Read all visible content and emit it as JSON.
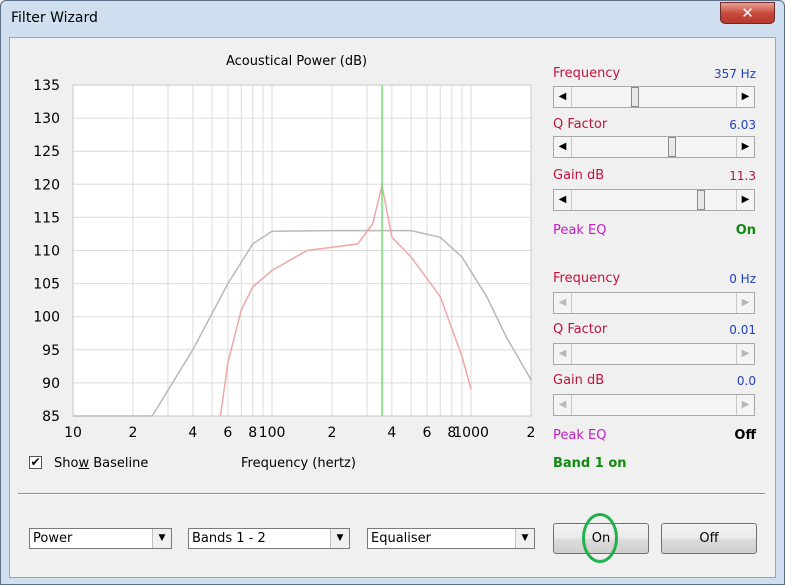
{
  "window": {
    "title": "Filter Wizard",
    "close_glyph": "✕"
  },
  "chart_data": {
    "type": "line",
    "title": "Acoustical Power (dB)",
    "xlabel": "Frequency (hertz)",
    "ylabel": "",
    "x_scale": "log",
    "xlim": [
      10,
      2000
    ],
    "ylim": [
      85,
      135
    ],
    "y_ticks": [
      "135",
      "130",
      "125",
      "120",
      "115",
      "110",
      "105",
      "100",
      "95",
      "90",
      "85"
    ],
    "x_ticks": [
      "10",
      "2",
      "4",
      "6",
      "8",
      "100",
      "2",
      "4",
      "6",
      "8",
      "1000",
      "2"
    ],
    "grid": true,
    "marker_frequency": 357,
    "series": [
      {
        "color": "#b8b8b8",
        "x": [
          10,
          25,
          40,
          60,
          80,
          100,
          200,
          500,
          700,
          900,
          1200,
          1500,
          2000
        ],
        "y": [
          85,
          85,
          95,
          105,
          111,
          112.9,
          113,
          113,
          112,
          109,
          103,
          97,
          90.5
        ]
      },
      {
        "color": "#f0a6a6",
        "x": [
          55,
          60,
          70,
          80,
          100,
          150,
          200,
          270,
          320,
          357,
          400,
          500,
          700,
          900,
          1000
        ],
        "y": [
          85,
          93,
          101,
          104.5,
          107,
          110,
          110.5,
          111,
          114,
          119.8,
          112,
          109,
          103,
          94,
          89
        ]
      }
    ]
  },
  "show_baseline": {
    "label_pre": "Sho",
    "label_accel": "w",
    "label_post": " Baseline",
    "checked": "✔"
  },
  "band1": {
    "frequency": {
      "label": "Frequency",
      "value": "357 Hz",
      "thumb_fraction": 0.38
    },
    "q_factor": {
      "label": "Q Factor",
      "value": "6.03",
      "thumb_fraction": 0.62
    },
    "gain": {
      "label": "Gain  dB",
      "value": "11.3",
      "value_color": "#c0143c",
      "thumb_fraction": 0.86
    },
    "peak_eq": {
      "label": "Peak EQ",
      "state": "On",
      "state_color": "#108a10"
    }
  },
  "band2": {
    "frequency": {
      "label": "Frequency",
      "value": "0 Hz"
    },
    "q_factor": {
      "label": "Q Factor",
      "value": "0.01"
    },
    "gain": {
      "label": "Gain  dB",
      "value": "0.0"
    },
    "peak_eq": {
      "label": "Peak EQ",
      "state": "Off",
      "state_color": "#000000"
    }
  },
  "band_state": "Band 1 on",
  "dropdowns": {
    "mode": "Power",
    "bands": "Bands 1 - 2",
    "type": "Equaliser",
    "arrow": "▼"
  },
  "buttons": {
    "on": "On",
    "off": "Off"
  },
  "slider_arrows": {
    "left": "◀",
    "right": "▶"
  }
}
